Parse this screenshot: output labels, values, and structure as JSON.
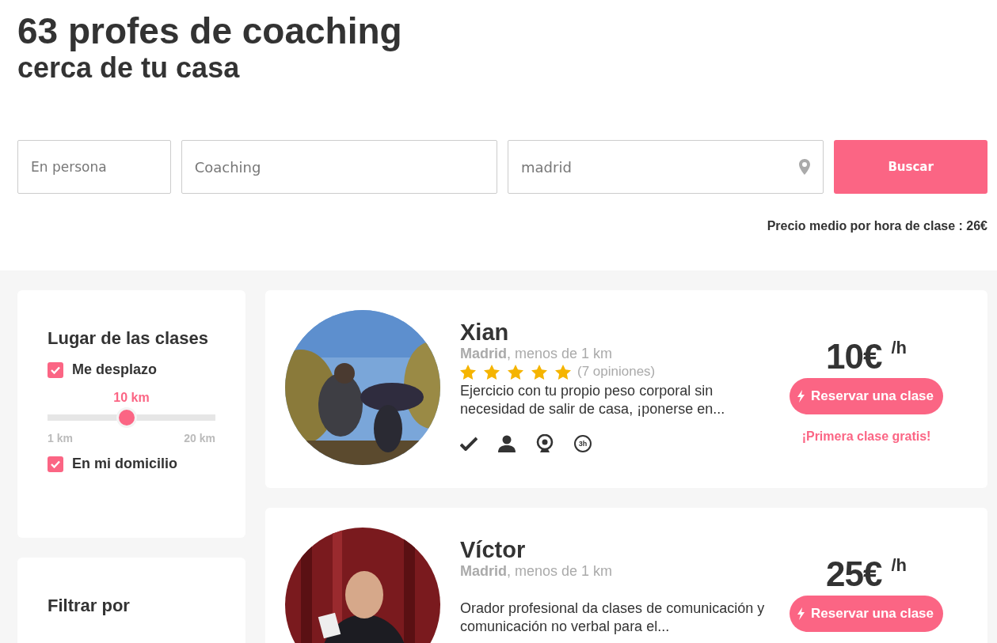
{
  "heading": {
    "title": "63 profes de coaching",
    "subtitle": "cerca de tu casa"
  },
  "search": {
    "fields": [
      {
        "kind": "select",
        "value": "En persona"
      },
      {
        "kind": "text",
        "value": "Coaching"
      },
      {
        "kind": "location",
        "value": "madrid"
      }
    ],
    "button": "Buscar",
    "average_price": "Precio medio por hora de clase : 26€"
  },
  "filters": {
    "place": {
      "title": "Lugar de las clases",
      "options": [
        {
          "label": "Me desplazo",
          "checked": true
        },
        {
          "label": "En mi domicilio",
          "checked": true
        }
      ],
      "distance": {
        "reading": "10 km",
        "level": 0.47,
        "min": "1 km",
        "max": "20 km"
      }
    },
    "sort": {
      "title": "Filtrar por"
    }
  },
  "tutors": [
    {
      "name": "Xian",
      "location": "**Madrid**, menos de 1 km",
      "stars": 5,
      "reviews": "(7 opiniones)",
      "description": "Ejercicio con tu propio peso corporal sin necesidad de salir de casa, ¡ponerse en...",
      "features": [
        {
          "kind": "verified"
        },
        {
          "kind": "profile"
        },
        {
          "kind": "webcam"
        },
        {
          "kind": "duration",
          "label": "3h"
        }
      ],
      "price": "10€",
      "unit": "/h",
      "button": "Reservar una clase",
      "promo": "¡Primera clase gratis!"
    },
    {
      "name": "Víctor",
      "location": "**Madrid**, menos de 1 km",
      "description": "Orador profesional da clases de comunicación y comunicación no verbal para el...",
      "price": "25€",
      "unit": "/h",
      "button": "Reservar una clase"
    }
  ]
}
